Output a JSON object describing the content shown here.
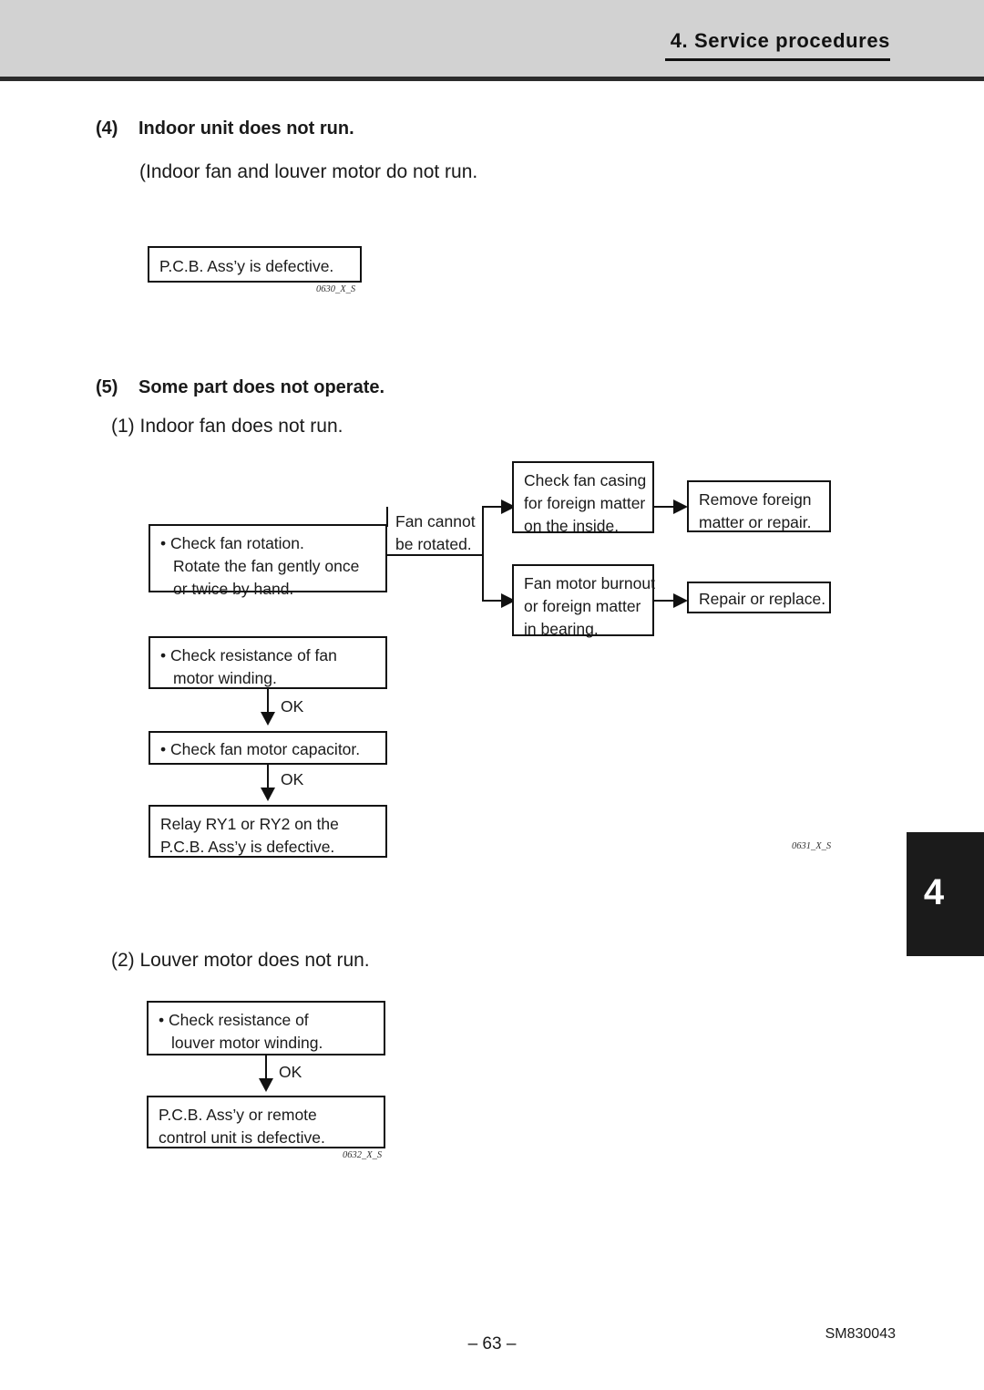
{
  "header": {
    "title": "4.  Service procedures"
  },
  "chapter_tab": {
    "number": "4"
  },
  "sections": [
    {
      "number": "(4)",
      "title": "Indoor unit does not run.",
      "subtitle": "(Indoor fan and louver motor do not run."
    },
    {
      "number": "(5)",
      "title": "Some part does not operate.",
      "sub1": "(1) Indoor fan does not run.",
      "sub2": "(2) Louver motor does not run."
    }
  ],
  "flow4": {
    "box_pcb": {
      "line1": "P.C.B. Ass’y is defective."
    },
    "figcode": "0630_X_S"
  },
  "flow5_1": {
    "box_check_rotation": {
      "line1": "• Check fan rotation.",
      "line2": "Rotate the fan gently once",
      "line3": "or twice by hand."
    },
    "label_fan_cannot": {
      "line1": "Fan cannot",
      "line2": "be rotated."
    },
    "box_check_casing": {
      "line1": "Check fan casing",
      "line2": "for foreign matter",
      "line3": "on the inside."
    },
    "box_remove_foreign": {
      "line1": "Remove foreign",
      "line2": "matter or repair."
    },
    "box_motor_burnout": {
      "line1": "Fan motor burnout",
      "line2": "or foreign matter",
      "line3": "in bearing."
    },
    "box_repair_replace": {
      "line1": "Repair or replace."
    },
    "box_check_resistance": {
      "line1": "• Check resistance of fan",
      "line2": "motor winding."
    },
    "box_check_capacitor": {
      "line1": "• Check fan motor capacitor."
    },
    "box_relay": {
      "line1": "Relay RY1 or RY2 on the",
      "line2": "P.C.B. Ass’y is defective."
    },
    "ok_label_1": "OK",
    "ok_label_2": "OK",
    "figcode": "0631_X_S"
  },
  "flow5_2": {
    "box_check_louver": {
      "line1": "• Check resistance of",
      "line2": "louver motor winding."
    },
    "box_pcb_remote": {
      "line1": "P.C.B. Ass’y or remote",
      "line2": "control unit is defective."
    },
    "ok_label": "OK",
    "figcode": "0632_X_S"
  },
  "footer": {
    "page_number": "– 63 –",
    "doc_code": "SM830043"
  }
}
